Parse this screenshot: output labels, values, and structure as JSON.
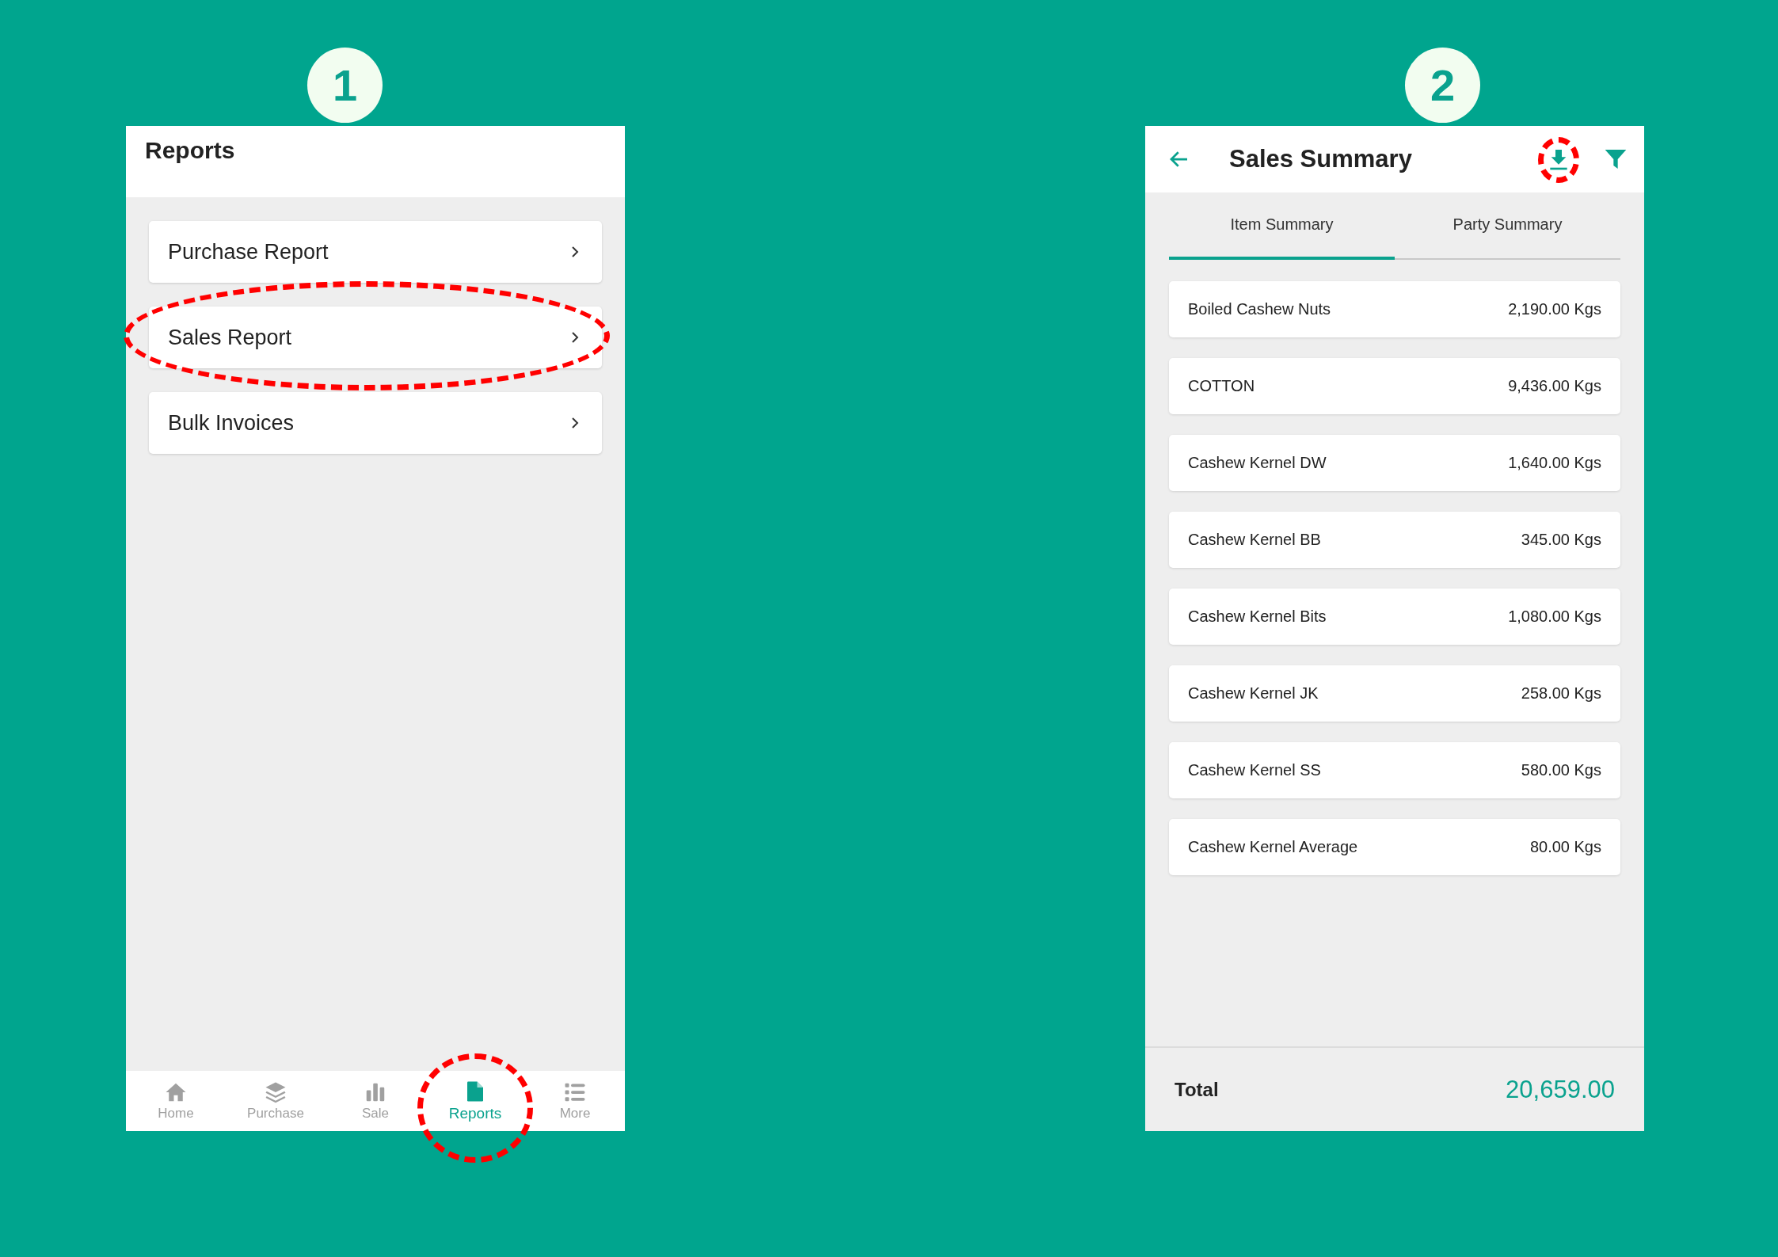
{
  "screens": [
    {
      "step": "1",
      "title": "Reports",
      "menu": [
        {
          "label": "Purchase Report",
          "highlighted": false
        },
        {
          "label": "Sales Report",
          "highlighted": true
        },
        {
          "label": "Bulk Invoices",
          "highlighted": false
        }
      ],
      "bottom_nav": [
        {
          "label": "Home",
          "kind": "home",
          "selected": false,
          "highlighted": false
        },
        {
          "label": "Purchase",
          "kind": "layers",
          "selected": false,
          "highlighted": false
        },
        {
          "label": "Sale",
          "kind": "bars",
          "selected": false,
          "highlighted": false
        },
        {
          "label": "Reports",
          "kind": "file",
          "selected": true,
          "highlighted": true
        },
        {
          "label": "More",
          "kind": "list",
          "selected": false,
          "highlighted": false
        }
      ]
    },
    {
      "step": "2",
      "title": "Sales Summary",
      "download_highlighted": true,
      "tabs": [
        {
          "label": "Item Summary",
          "selected": true
        },
        {
          "label": "Party Summary",
          "selected": false
        }
      ],
      "rows": [
        {
          "name": "Boiled Cashew Nuts",
          "quantity": "2,190.00 Kgs"
        },
        {
          "name": "COTTON",
          "quantity": "9,436.00 Kgs"
        },
        {
          "name": "Cashew Kernel DW",
          "quantity": "1,640.00 Kgs"
        },
        {
          "name": "Cashew Kernel BB",
          "quantity": "345.00 Kgs"
        },
        {
          "name": "Cashew Kernel Bits",
          "quantity": "1,080.00 Kgs"
        },
        {
          "name": "Cashew Kernel JK",
          "quantity": "258.00 Kgs"
        },
        {
          "name": "Cashew Kernel SS",
          "quantity": "580.00 Kgs"
        },
        {
          "name": "Cashew Kernel Average",
          "quantity": "80.00 Kgs"
        }
      ],
      "total": {
        "label": "Total",
        "value": "20,659.00"
      }
    }
  ]
}
